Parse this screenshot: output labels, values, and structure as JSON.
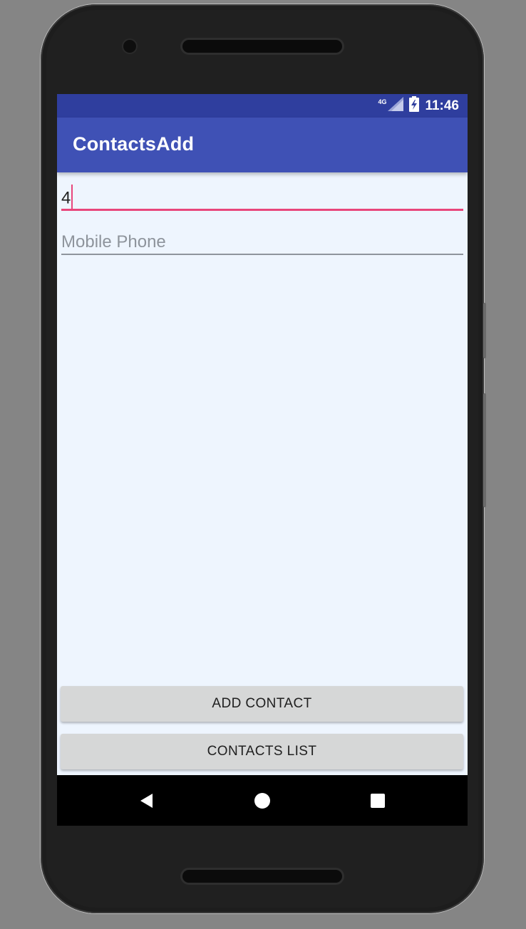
{
  "status_bar": {
    "network": "4G",
    "time": "11:46"
  },
  "app_bar": {
    "title": "ContactsAdd"
  },
  "form": {
    "name_value": "4",
    "mobile_placeholder": "Mobile Phone"
  },
  "buttons": {
    "add_contact": "ADD CONTACT",
    "contacts_list": "CONTACTS LIST"
  },
  "nav_bar": {
    "icons": [
      "back-icon",
      "home-icon",
      "recents-icon"
    ]
  },
  "colors": {
    "status_bar": "#2f3e9e",
    "app_bar": "#3f51b5",
    "accent": "#e8467c",
    "screen_bg": "#eef5fe",
    "button_bg": "#d6d7d7"
  }
}
